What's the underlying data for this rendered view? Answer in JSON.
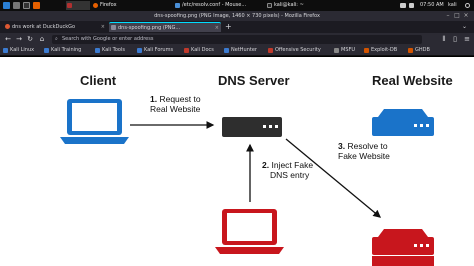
{
  "panel": {
    "tasks": [
      {
        "label": ""
      },
      {
        "label": "Firefox"
      },
      {
        "label": "/etc/resolv.conf - Mouse..."
      },
      {
        "label": "kali@kali: ~"
      }
    ],
    "clock": "07:50 AM",
    "user": "kali"
  },
  "window": {
    "title": "dns-spoofing.png (PNG Image, 1460 × 730 pixels) - Mozilla Firefox"
  },
  "tabs": [
    {
      "label": "dns work at DuckDuckGo",
      "active": false
    },
    {
      "label": "dns-spoofing.png (PNG...",
      "active": true
    }
  ],
  "navbar": {
    "back": "←",
    "forward": "→",
    "reload": "↻",
    "url_placeholder": "Search with Google or enter address"
  },
  "bookmarks": [
    {
      "label": "Kali Linux"
    },
    {
      "label": "Kali Training"
    },
    {
      "label": "Kali Tools"
    },
    {
      "label": "Kali Forums"
    },
    {
      "label": "Kali Docs"
    },
    {
      "label": "NetHunter"
    },
    {
      "label": "Offensive Security"
    },
    {
      "label": "MSFU"
    },
    {
      "label": "Exploit-DB"
    },
    {
      "label": "GHDB"
    }
  ],
  "diagram": {
    "headings": {
      "client": "Client",
      "dns_server": "DNS Server",
      "real_website": "Real Website"
    },
    "steps": {
      "step1_num": "1.",
      "step1_line1": "Request to",
      "step1_line2": "Real Website",
      "step2_num": "2.",
      "step2_line1": "Inject Fake",
      "step2_line2": "DNS entry",
      "step3_num": "3.",
      "step3_line1": "Resolve to",
      "step3_line2": "Fake Website"
    },
    "colors": {
      "client_blue": "#1a73c9",
      "server_dark": "#2e2e2e",
      "real_blue": "#1a73c9",
      "attacker_red": "#c8161d"
    }
  }
}
